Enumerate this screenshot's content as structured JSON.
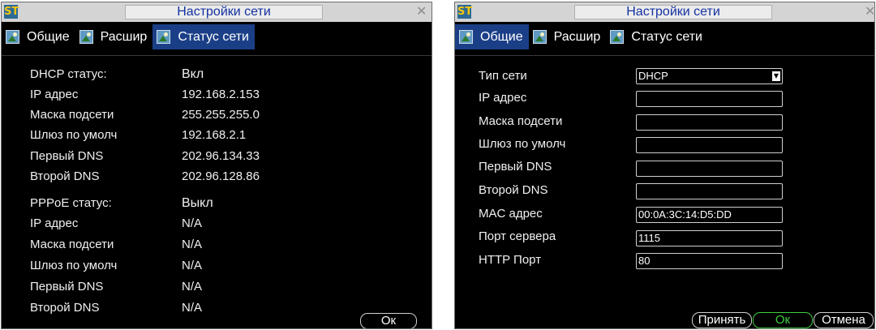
{
  "window_left": {
    "logo": "ST",
    "title": "Настройки сети",
    "tabs": [
      "Общие",
      "Расшир",
      "Статус сети"
    ],
    "rows": [
      {
        "label": "DHCP статус:",
        "value": "Вкл"
      },
      {
        "label": "IP адрес",
        "value": "192.168.2.153"
      },
      {
        "label": "Маска подсети",
        "value": "255.255.255.0"
      },
      {
        "label": "Шлюз по умолч",
        "value": "192.168.2.1"
      },
      {
        "label": "Первый DNS",
        "value": "202.96.134.33"
      },
      {
        "label": "Второй DNS",
        "value": "202.96.128.86"
      },
      {
        "label": "PPPoE статус:",
        "value": "Выкл"
      },
      {
        "label": "IP адрес",
        "value": "N/A"
      },
      {
        "label": "Маска подсети",
        "value": "N/A"
      },
      {
        "label": "Шлюз по умолч",
        "value": "N/A"
      },
      {
        "label": "Первый DNS",
        "value": "N/A"
      },
      {
        "label": "Второй DNS",
        "value": "N/A"
      }
    ],
    "ok_label": "Ок"
  },
  "window_right": {
    "logo": "ST",
    "title": "Настройки сети",
    "tabs": [
      "Общие",
      "Расшир",
      "Статус сети"
    ],
    "fields": [
      {
        "label": "Тип сети",
        "value": "DHCP"
      },
      {
        "label": "IP адрес",
        "value": ""
      },
      {
        "label": "Маска подсети",
        "value": ""
      },
      {
        "label": "Шлюз по умолч",
        "value": ""
      },
      {
        "label": "Первый DNS",
        "value": ""
      },
      {
        "label": "Второй DNS",
        "value": ""
      },
      {
        "label": "MAC адрес",
        "value": "00:0A:3C:14:D5:DD"
      },
      {
        "label": "Порт сервера",
        "value": "1115"
      },
      {
        "label": "HTTP Порт",
        "value": "80"
      }
    ],
    "buttons": {
      "apply": "Принять",
      "ok": "Ок",
      "cancel": "Отмена"
    }
  }
}
